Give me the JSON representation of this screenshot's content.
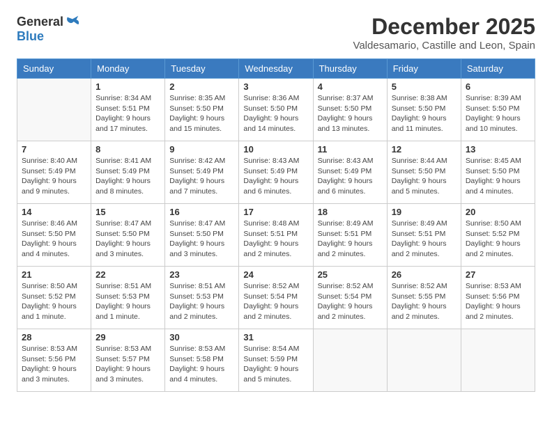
{
  "logo": {
    "general": "General",
    "blue": "Blue"
  },
  "title": {
    "month": "December 2025",
    "location": "Valdesamario, Castille and Leon, Spain"
  },
  "weekdays": [
    "Sunday",
    "Monday",
    "Tuesday",
    "Wednesday",
    "Thursday",
    "Friday",
    "Saturday"
  ],
  "weeks": [
    [
      {
        "day": null,
        "sunrise": null,
        "sunset": null,
        "daylight": null
      },
      {
        "day": 1,
        "sunrise": "8:34 AM",
        "sunset": "5:51 PM",
        "daylight": "9 hours and 17 minutes."
      },
      {
        "day": 2,
        "sunrise": "8:35 AM",
        "sunset": "5:50 PM",
        "daylight": "9 hours and 15 minutes."
      },
      {
        "day": 3,
        "sunrise": "8:36 AM",
        "sunset": "5:50 PM",
        "daylight": "9 hours and 14 minutes."
      },
      {
        "day": 4,
        "sunrise": "8:37 AM",
        "sunset": "5:50 PM",
        "daylight": "9 hours and 13 minutes."
      },
      {
        "day": 5,
        "sunrise": "8:38 AM",
        "sunset": "5:50 PM",
        "daylight": "9 hours and 11 minutes."
      },
      {
        "day": 6,
        "sunrise": "8:39 AM",
        "sunset": "5:50 PM",
        "daylight": "9 hours and 10 minutes."
      }
    ],
    [
      {
        "day": 7,
        "sunrise": "8:40 AM",
        "sunset": "5:49 PM",
        "daylight": "9 hours and 9 minutes."
      },
      {
        "day": 8,
        "sunrise": "8:41 AM",
        "sunset": "5:49 PM",
        "daylight": "9 hours and 8 minutes."
      },
      {
        "day": 9,
        "sunrise": "8:42 AM",
        "sunset": "5:49 PM",
        "daylight": "9 hours and 7 minutes."
      },
      {
        "day": 10,
        "sunrise": "8:43 AM",
        "sunset": "5:49 PM",
        "daylight": "9 hours and 6 minutes."
      },
      {
        "day": 11,
        "sunrise": "8:43 AM",
        "sunset": "5:49 PM",
        "daylight": "9 hours and 6 minutes."
      },
      {
        "day": 12,
        "sunrise": "8:44 AM",
        "sunset": "5:50 PM",
        "daylight": "9 hours and 5 minutes."
      },
      {
        "day": 13,
        "sunrise": "8:45 AM",
        "sunset": "5:50 PM",
        "daylight": "9 hours and 4 minutes."
      }
    ],
    [
      {
        "day": 14,
        "sunrise": "8:46 AM",
        "sunset": "5:50 PM",
        "daylight": "9 hours and 4 minutes."
      },
      {
        "day": 15,
        "sunrise": "8:47 AM",
        "sunset": "5:50 PM",
        "daylight": "9 hours and 3 minutes."
      },
      {
        "day": 16,
        "sunrise": "8:47 AM",
        "sunset": "5:50 PM",
        "daylight": "9 hours and 3 minutes."
      },
      {
        "day": 17,
        "sunrise": "8:48 AM",
        "sunset": "5:51 PM",
        "daylight": "9 hours and 2 minutes."
      },
      {
        "day": 18,
        "sunrise": "8:49 AM",
        "sunset": "5:51 PM",
        "daylight": "9 hours and 2 minutes."
      },
      {
        "day": 19,
        "sunrise": "8:49 AM",
        "sunset": "5:51 PM",
        "daylight": "9 hours and 2 minutes."
      },
      {
        "day": 20,
        "sunrise": "8:50 AM",
        "sunset": "5:52 PM",
        "daylight": "9 hours and 2 minutes."
      }
    ],
    [
      {
        "day": 21,
        "sunrise": "8:50 AM",
        "sunset": "5:52 PM",
        "daylight": "9 hours and 1 minute."
      },
      {
        "day": 22,
        "sunrise": "8:51 AM",
        "sunset": "5:53 PM",
        "daylight": "9 hours and 1 minute."
      },
      {
        "day": 23,
        "sunrise": "8:51 AM",
        "sunset": "5:53 PM",
        "daylight": "9 hours and 2 minutes."
      },
      {
        "day": 24,
        "sunrise": "8:52 AM",
        "sunset": "5:54 PM",
        "daylight": "9 hours and 2 minutes."
      },
      {
        "day": 25,
        "sunrise": "8:52 AM",
        "sunset": "5:54 PM",
        "daylight": "9 hours and 2 minutes."
      },
      {
        "day": 26,
        "sunrise": "8:52 AM",
        "sunset": "5:55 PM",
        "daylight": "9 hours and 2 minutes."
      },
      {
        "day": 27,
        "sunrise": "8:53 AM",
        "sunset": "5:56 PM",
        "daylight": "9 hours and 2 minutes."
      }
    ],
    [
      {
        "day": 28,
        "sunrise": "8:53 AM",
        "sunset": "5:56 PM",
        "daylight": "9 hours and 3 minutes."
      },
      {
        "day": 29,
        "sunrise": "8:53 AM",
        "sunset": "5:57 PM",
        "daylight": "9 hours and 3 minutes."
      },
      {
        "day": 30,
        "sunrise": "8:53 AM",
        "sunset": "5:58 PM",
        "daylight": "9 hours and 4 minutes."
      },
      {
        "day": 31,
        "sunrise": "8:54 AM",
        "sunset": "5:59 PM",
        "daylight": "9 hours and 5 minutes."
      },
      {
        "day": null,
        "sunrise": null,
        "sunset": null,
        "daylight": null
      },
      {
        "day": null,
        "sunrise": null,
        "sunset": null,
        "daylight": null
      },
      {
        "day": null,
        "sunrise": null,
        "sunset": null,
        "daylight": null
      }
    ]
  ]
}
